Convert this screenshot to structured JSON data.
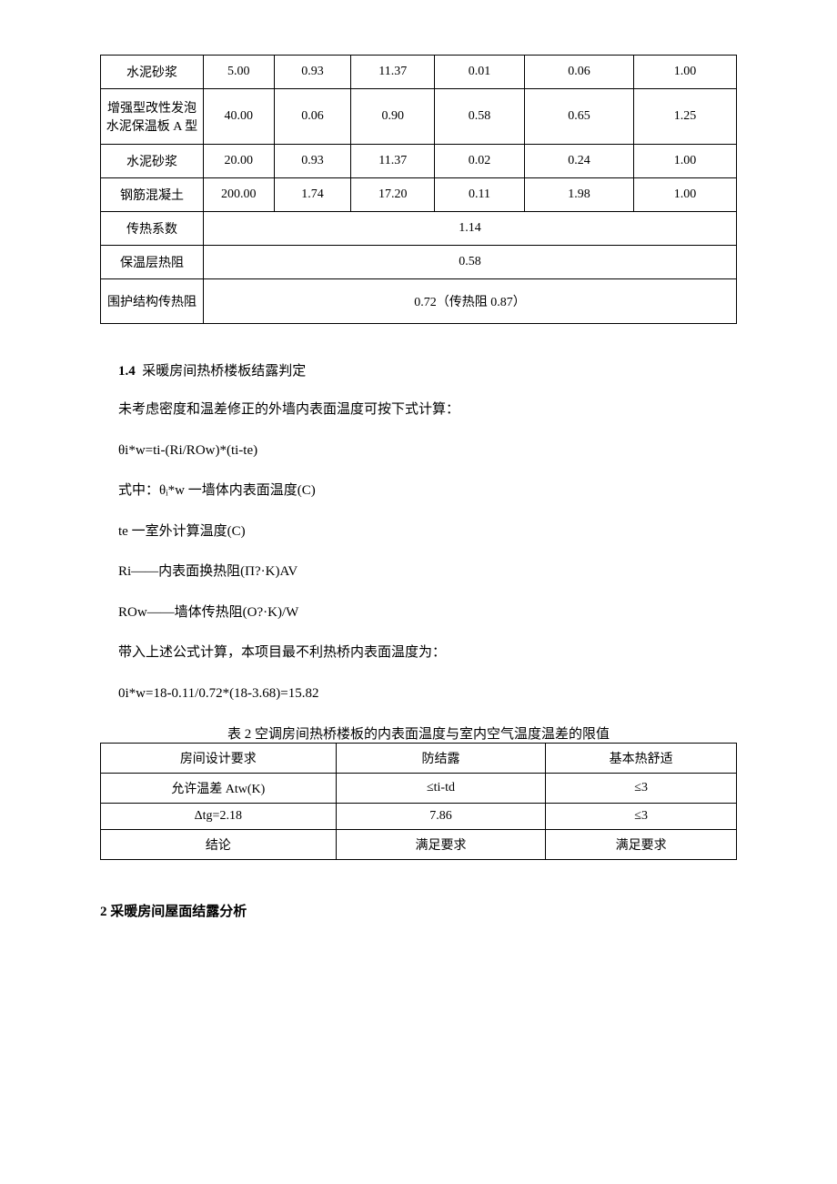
{
  "table1": {
    "rows": [
      {
        "c0": "水泥砂浆",
        "c1": "5.00",
        "c2": "0.93",
        "c3": "11.37",
        "c4": "0.01",
        "c5": "0.06",
        "c6": "1.00"
      },
      {
        "c0": "增强型改性发泡水泥保温板 A 型",
        "c1": "40.00",
        "c2": "0.06",
        "c3": "0.90",
        "c4": "0.58",
        "c5": "0.65",
        "c6": "1.25"
      },
      {
        "c0": "水泥砂浆",
        "c1": "20.00",
        "c2": "0.93",
        "c3": "11.37",
        "c4": "0.02",
        "c5": "0.24",
        "c6": "1.00"
      },
      {
        "c0": "钢筋混凝土",
        "c1": "200.00",
        "c2": "1.74",
        "c3": "17.20",
        "c4": "0.11",
        "c5": "1.98",
        "c6": "1.00"
      }
    ],
    "summary": [
      {
        "label": "传热系数",
        "value": "1.14"
      },
      {
        "label": "保温层热阻",
        "value": "0.58"
      },
      {
        "label": "围护结构传热阻",
        "value": "0.72（传热阻 0.87）"
      }
    ]
  },
  "section14": {
    "num": "1.4",
    "title": "采暖房间热桥楼板结露判定",
    "paras": [
      "未考虑密度和温差修正的外墙内表面温度可按下式计算：",
      "θi*w=ti-(Ri/ROw)*(ti-te)",
      "式中：θᵢ*w 一墙体内表面温度(C)",
      "te 一室外计算温度(C)",
      "Ri——内表面换热阻(Π?·K)AV",
      "ROw——墙体传热阻(O?·K)/W",
      "带入上述公式计算，本项目最不利热桥内表面温度为：",
      "0i*w=18-0.11/0.72*(18-3.68)=15.82"
    ]
  },
  "table2": {
    "caption": "表 2 空调房间热桥楼板的内表面温度与室内空气温度温差的限值",
    "rows": [
      {
        "c0": "房间设计要求",
        "c1": "防结露",
        "c2": "基本热舒适"
      },
      {
        "c0": "允许温差 Atw(K)",
        "c1": "≤ti-td",
        "c2": "≤3"
      },
      {
        "c0": "Δtg=2.18",
        "c1": "7.86",
        "c2": "≤3"
      },
      {
        "c0": "结论",
        "c1": "满足要求",
        "c2": "满足要求"
      }
    ]
  },
  "section2": {
    "title": "2 采暖房间屋面结露分析"
  }
}
